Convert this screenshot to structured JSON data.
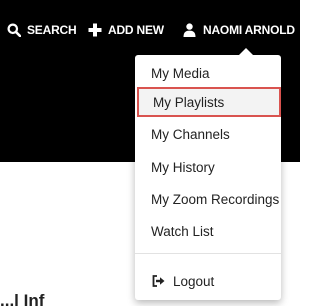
{
  "header": {
    "search_label": "SEARCH",
    "add_new_label": "ADD NEW",
    "user_name": "NAOMI ARNOLD",
    "icons": {
      "search": "search-icon",
      "add": "plus-icon",
      "user": "user-icon"
    }
  },
  "user_menu": {
    "items": [
      {
        "label": "My Media"
      },
      {
        "label": "My Playlists",
        "highlighted": true
      },
      {
        "label": "My Channels"
      },
      {
        "label": "My History"
      },
      {
        "label": "My Zoom Recordings"
      },
      {
        "label": "Watch List"
      }
    ],
    "logout": {
      "label": "Logout",
      "icon": "logout-icon"
    }
  },
  "page": {
    "partial_heading": "...l Inf"
  },
  "colors": {
    "topbar": "#000000",
    "highlight_border": "#d9534f",
    "menu_text": "#222222"
  }
}
